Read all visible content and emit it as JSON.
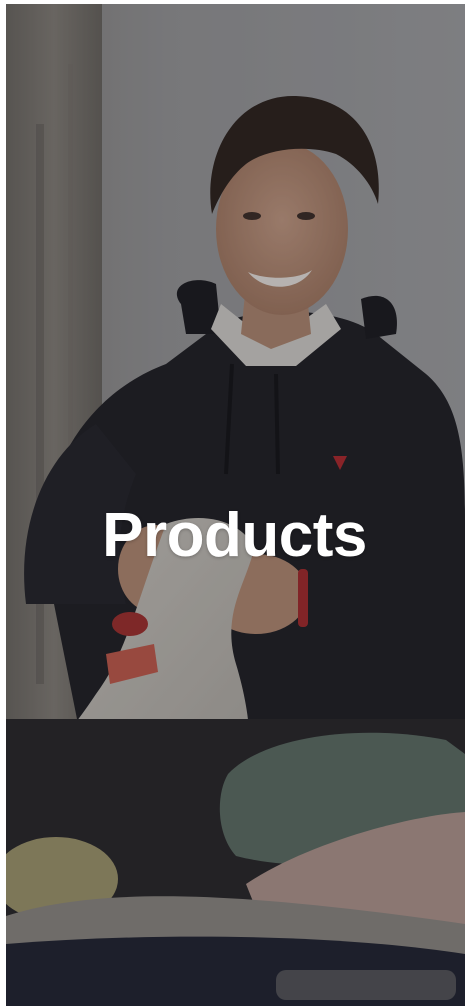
{
  "hero": {
    "title": "Products"
  },
  "photo": {
    "subject": "person-smiling-holding-fabric-bag"
  },
  "colors": {
    "title": "#ffffff",
    "overlay": "#1e1e22"
  }
}
